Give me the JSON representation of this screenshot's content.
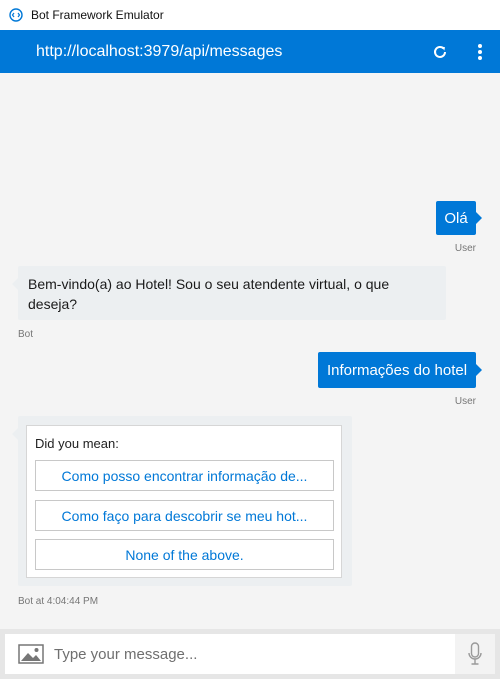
{
  "window": {
    "title": "Bot Framework Emulator"
  },
  "header": {
    "url": "http://localhost:3979/api/messages",
    "accent": "#0078d7"
  },
  "messages": {
    "m1": {
      "text": "Olá",
      "sender": "User"
    },
    "m2": {
      "line1": "Bem-vindo(a) ao Hotel! Sou o seu atendente virtual, o que",
      "line2": "deseja?",
      "sender": "Bot"
    },
    "m3": {
      "text": "Informações do hotel",
      "sender": "User"
    },
    "m4": {
      "prompt": "Did you mean:",
      "options": [
        "Como posso encontrar informação de...",
        "Como faço para descobrir se meu hot...",
        "None of the above."
      ],
      "sender": "Bot at 4:04:44 PM"
    }
  },
  "composer": {
    "placeholder": "Type your message..."
  },
  "icons": {
    "app": "bot-emulator-icon",
    "refresh": "refresh-icon",
    "more": "more-vertical-icon",
    "image": "image-upload-icon",
    "mic": "microphone-icon"
  }
}
